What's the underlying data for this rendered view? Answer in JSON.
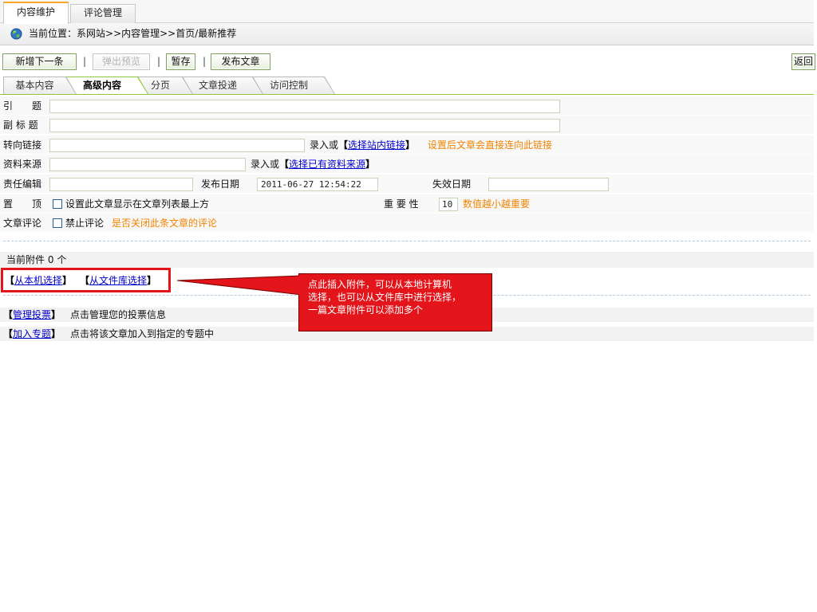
{
  "brackets": {
    "open": "【",
    "close": "】"
  },
  "top_tabs": [
    {
      "label": "内容维护",
      "active": true
    },
    {
      "label": "评论管理",
      "active": false
    }
  ],
  "breadcrumb": {
    "label": "当前位置：",
    "path": "系网站>>内容管理>>首页/最新推荐"
  },
  "toolbar": {
    "add_next_label": "新增下一条",
    "separator": "|",
    "preview_label": "弹出预览",
    "save_draft_label": "暂存",
    "publish_label": "发布文章",
    "back_label": "返回"
  },
  "sub_tabs": [
    {
      "label": "基本内容",
      "active": false
    },
    {
      "label": "高级内容",
      "active": true
    },
    {
      "label": "分页",
      "active": false
    },
    {
      "label": "文章投递",
      "active": false
    },
    {
      "label": "访问控制",
      "active": false
    }
  ],
  "form": {
    "intro_title": {
      "label": "引　　题",
      "value": ""
    },
    "subtitle": {
      "label": "副 标 题",
      "value": ""
    },
    "redirect_link": {
      "label": "转向链接",
      "value": "",
      "prefix": "录入或",
      "link": "选择站内链接",
      "hint": "设置后文章会直接连向此链接"
    },
    "source": {
      "label": "资料来源",
      "value": "",
      "prefix": "录入或",
      "link": "选择已有资料来源"
    },
    "editor": {
      "label": "责任编辑",
      "value": ""
    },
    "publish_date": {
      "label": "发布日期",
      "value": "2011-06-27 12:54:22"
    },
    "expire_date": {
      "label": "失效日期",
      "value": ""
    },
    "pin_top": {
      "label": "置　　顶",
      "checked": false,
      "checkbox_label": "设置此文章显示在文章列表最上方"
    },
    "importance": {
      "label": "重 要 性",
      "value": "10",
      "hint": "数值越小越重要"
    },
    "comments": {
      "label": "文章评论",
      "checked": false,
      "checkbox_label": "禁止评论",
      "hint": "是否关闭此条文章的评论"
    }
  },
  "attachments": {
    "label": "当前附件",
    "count": "0",
    "unit": "个",
    "local_link": "从本机选择",
    "library_link": "从文件库选择"
  },
  "callout": {
    "lines": [
      "点此插入附件，可以从本地计算机",
      "选择，也可以从文件库中进行选择，",
      "一篇文章附件可以添加多个"
    ]
  },
  "extras": [
    {
      "link": "管理投票",
      "desc": "点击管理您的投票信息"
    },
    {
      "link": "加入专题",
      "desc": "点击将该文章加入到指定的专题中"
    }
  ],
  "icons": {
    "breadcrumb": "globe-icon"
  },
  "colors": {
    "hint_text": "#f08300",
    "link": "#0000cc",
    "callout_bg": "#e3141a",
    "highlight_box": "#e3141a",
    "top_tab_accent": "#f5a623",
    "sub_tab_line": "#8dc63f",
    "dashed_rule": "#b3c9e2"
  }
}
